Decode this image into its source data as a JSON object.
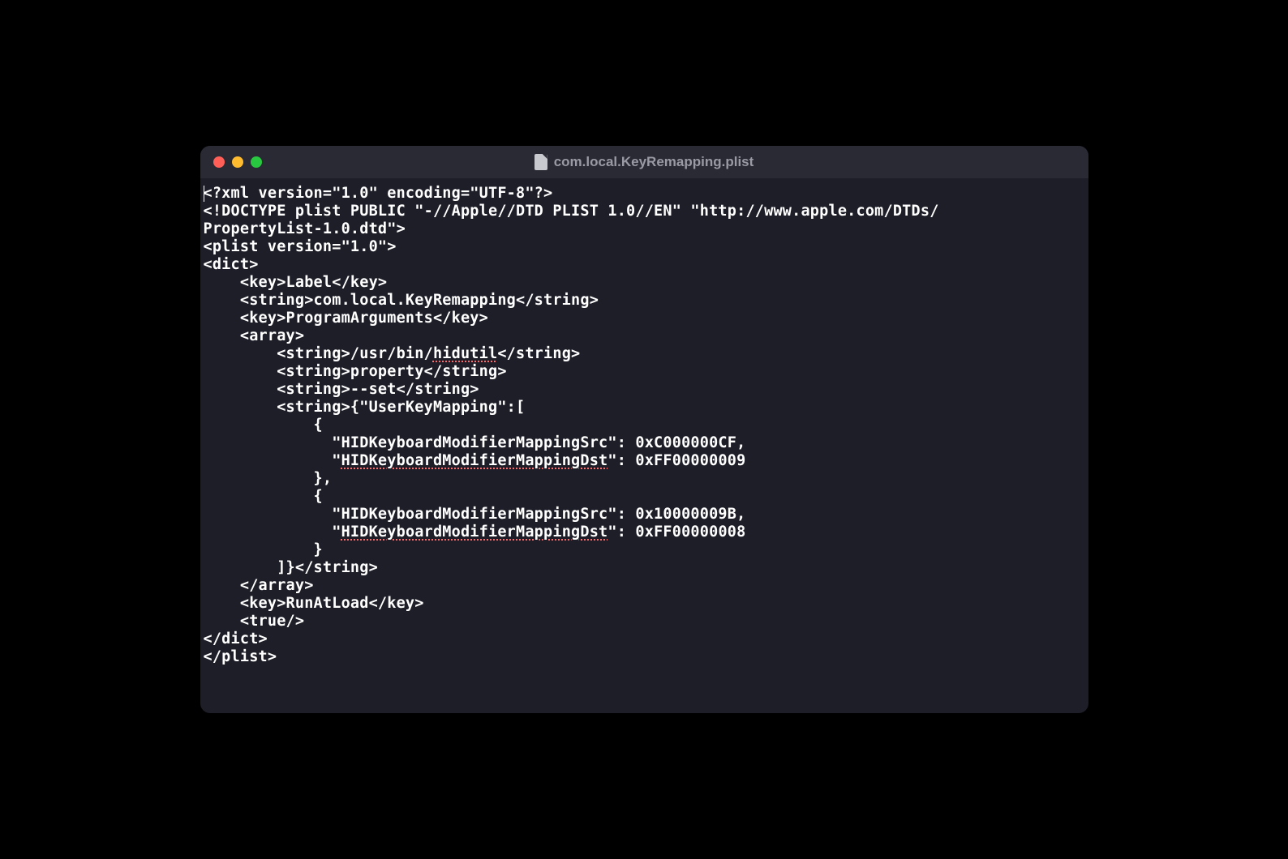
{
  "window": {
    "trafficLights": {
      "close": "close",
      "minimize": "minimize",
      "maximize": "maximize"
    },
    "title": "com.local.KeyRemapping.plist"
  },
  "editor": {
    "lines": [
      "<?xml version=\"1.0\" encoding=\"UTF-8\"?>",
      "<!DOCTYPE plist PUBLIC \"-//Apple//DTD PLIST 1.0//EN\" \"http://www.apple.com/DTDs/",
      "PropertyList-1.0.dtd\">",
      "<plist version=\"1.0\">",
      "<dict>",
      "    <key>Label</key>",
      "    <string>com.local.KeyRemapping</string>",
      "    <key>ProgramArguments</key>",
      "    <array>",
      "        <string>/usr/bin/hidutil</string>",
      "        <string>property</string>",
      "        <string>--set</string>",
      "        <string>{\"UserKeyMapping\":[",
      "            {",
      "              \"HIDKeyboardModifierMappingSrc\": 0xC000000CF,",
      "              \"HIDKeyboardModifierMappingDst\": 0xFF00000009",
      "            },",
      "            {",
      "              \"HIDKeyboardModifierMappingSrc\": 0x10000009B,",
      "              \"HIDKeyboardModifierMappingDst\": 0xFF00000008",
      "            }",
      "        ]}</string>",
      "    </array>",
      "    <key>RunAtLoad</key>",
      "    <true/>",
      "</dict>",
      "</plist>"
    ],
    "spellWords": {
      "hidutil": "hidutil",
      "dst1": "HIDKeyboardModifierMappingDst",
      "dst2": "HIDKeyboardModifierMappingDst"
    }
  }
}
